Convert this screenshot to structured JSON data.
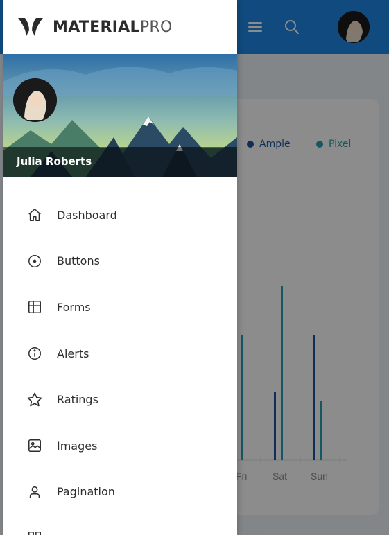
{
  "brand": {
    "name_bold": "MATERIAL",
    "name_light": "PRO"
  },
  "profile": {
    "name": "Julia Roberts"
  },
  "nav": {
    "items": [
      {
        "label": "Dashboard",
        "icon": "home-icon"
      },
      {
        "label": "Buttons",
        "icon": "radio-circle-icon"
      },
      {
        "label": "Forms",
        "icon": "layout-grid-icon"
      },
      {
        "label": "Alerts",
        "icon": "info-circle-icon"
      },
      {
        "label": "Ratings",
        "icon": "star-icon"
      },
      {
        "label": "Images",
        "icon": "image-icon"
      },
      {
        "label": "Pagination",
        "icon": "user-icon"
      }
    ]
  },
  "background": {
    "legend": [
      {
        "label": "Ample",
        "color": "#1e56a0"
      },
      {
        "label": "Pixel",
        "color": "#26a0b5"
      }
    ],
    "chart_labels": [
      "Fri",
      "Sat",
      "Sun"
    ]
  },
  "colors": {
    "topbar": "#1e88e5",
    "ample": "#1e56a0",
    "pixel": "#26a0b5"
  }
}
